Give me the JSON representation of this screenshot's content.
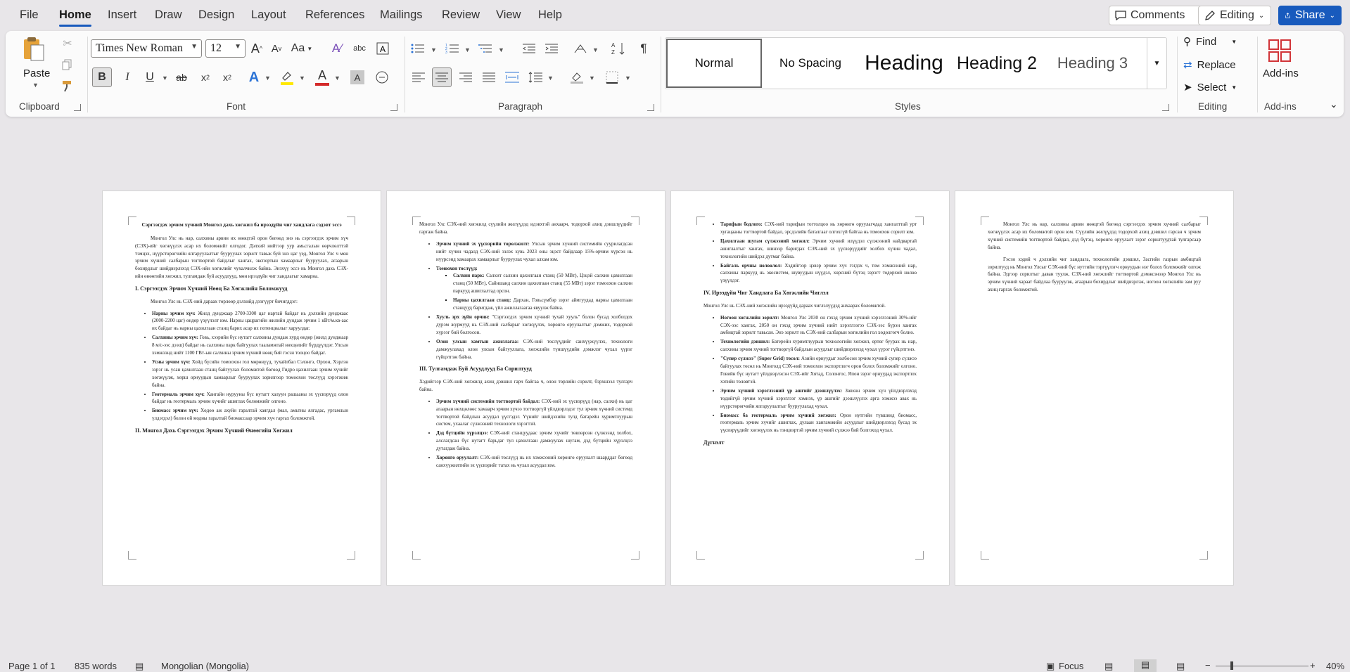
{
  "menu": [
    "File",
    "Home",
    "Insert",
    "Draw",
    "Design",
    "Layout",
    "References",
    "Mailings",
    "Review",
    "View",
    "Help"
  ],
  "menu_active": "Home",
  "topbar": {
    "comments": "Comments",
    "editing": "Editing",
    "share": "Share"
  },
  "ribbon": {
    "clipboard": {
      "label": "Clipboard",
      "paste": "Paste"
    },
    "font": {
      "label": "Font",
      "family": "Times New Roman",
      "size": "12"
    },
    "paragraph": {
      "label": "Paragraph"
    },
    "styles": {
      "label": "Styles",
      "items": [
        "Normal",
        "No Spacing",
        "Heading",
        "Heading 2",
        "Heading 3"
      ]
    },
    "editing": {
      "label": "Editing",
      "find": "Find",
      "replace": "Replace",
      "select": "Select"
    },
    "addins": {
      "label": "Add-ins",
      "button": "Add-ins"
    }
  },
  "status": {
    "page": "Page 1 of 1",
    "words": "835 words",
    "language": "Mongolian (Mongolia)",
    "focus": "Focus",
    "zoom": "40%"
  },
  "pages": [
    {
      "blocks": [
        {
          "t": "title",
          "text": "Сэргээгдэх эрчим хүчний Монгол дахь хөгжил ба ирээдүйн чиг хандлага сэдэвт эссэ"
        },
        {
          "t": "p",
          "text": "Монгол Улс нь нар, салхины арвин их нөөцтэй орон бөгөөд энэ нь сэргээгдэх эрчим хүч (СЭХ)-ийг хөгжүүлэх асар их боломжийг олгодог. Дэлхий нийтээр уур амьсгалын өөрчлөлттэй тэмцэх, нүүрстөрөгчийн ялгаруулалтыг бууруулах зорилт тавьж буй энэ цаг үед, Монгол Улс ч мөн эрчим хүчний салбарын тогтвортой байдлыг хангах, экспортын хамаарлыг бууруулах, агаарын бохирдлыг шийдвэрлэхэд СЭХ-ийн хөгжлийг чухалчилж байна. Энэхүү эссэ нь Монгол дахь СЭХ-ийн өнөөгийн хөгжил, тулгамдаж буй асуудлууд, мөн ирээдүйн чиг хандлагыг хамарна."
        },
        {
          "t": "h",
          "text": "I. Сэргээгдэх Эрчим Хүчний Нөөц Ба Хөгжлийн Боломжууд"
        },
        {
          "t": "p",
          "text": "Монгол Улс нь СЭХ-ний дараах төрлөөр дэлхийд дээгүүрт бичигддэг:"
        },
        {
          "t": "ul",
          "items": [
            {
              "b": "Нарны эрчим хүч:",
              "text": "Жилд дунджаар 2700-3300 цаг нартай байдаг нь дэлхийн дунджаас (2000-2200 цаг) өндөр үзүүлэлт юм. Нарны цацрагийн жилийн дундаж эрчим 1 кВт/м.кв-аас их байдаг нь нарны цахилгаан станц барих асар их потенциалыг харуулдаг."
            },
            {
              "b": "Салхины эрчим хүч:",
              "text": "Говь, хээрийн бүс нутагт салхины дундаж хурд өндөр (жилд дунджаар 8 м/с-ээс дээш) байдаг нь салхины парк байгуулах тааламжтай нөхцөлийг бүрдүүлдэг. Улсын хэмжээнд нийт 1100 ГВт-ын салхины эрчим хүчний нөөц бий гэсэн тооцоо байдаг."
            },
            {
              "b": "Усны эрчим хүч:",
              "text": "Хойд бүсийн томоохон гол мөрөнүүд, тухайлбал Сэлэнгэ, Орхон, Хэрлэн зэрэг нь усан цахилгаан станц байгуулах боломжтой бөгөөд Гидро цахилгаан эрчим хүчийг хөгжүүлж, хөрш орнуудын хамаарлыг бууруулах зорилгоор томоохон төслүүд хэрэгжиж байна."
            },
            {
              "b": "Геотермаль эрчим хүч:",
              "text": "Хангайн нурууны бүс нутагт халуун рашааны эх үүсвэрүүд олон байдаг нь геотермаль эрчим хүчийг ашиглах боломжийг олгоно."
            },
            {
              "b": "Биомасс эрчим хүч:",
              "text": "Хөдөө аж ахуйн гаралтай хаягдал (мал, амьтны ялгадас, ургамлын үлдэгдэл) болон ой модны гаралтай биомассаар эрчим хүч гаргах боломжтой."
            }
          ]
        },
        {
          "t": "h",
          "text": "II. Монгол Дахь Сэргээгдэх Эрчим Хүчний Өнөөгийн Хөгжил"
        }
      ]
    },
    {
      "blocks": [
        {
          "t": "p",
          "noindent": true,
          "text": "Монгол Улс СЭХ-ний хөгжилд сүүлийн жилүүдэд идэвхтэй анхаарч, тодорхой ахиц дэвшлүүдийг гаргаж байна."
        },
        {
          "t": "ul",
          "items": [
            {
              "b": "Эрчим хүчний эх үүсвэрийн төрөлжилт:",
              "text": "Улсын эрчим хүчний системийн суурилагдсан нийт хүчин чадалд СЭХ-ний эзлэх хувь 2023 оны эцэст байдлаар 15%-орчим хүрсэн нь нүүрсэнд хамаарах хамаарлыг бууруулах чухал алхам юм."
            },
            {
              "b": "Томоохон төслүүд:",
              "text": "",
              "sub": [
                {
                  "b": "Салхин парк:",
                  "text": "Салхит салхин цахилгаан станц (50 МВт), Цэцэй салхин цахилгаан станц (50 МВт), Сайншанд салхин цахилгаан станц (55 МВт) зэрэг томоохон салхин паркууд ашиглалтад орсон."
                },
                {
                  "b": "Нарны цахилгаан станц:",
                  "text": "Дархан, Говьсүмбэр зэрэг аймгуудад нарны цахилгаан станцууд баригдаж, үйл ажиллагаагаа явуулж байна."
                }
              ]
            },
            {
              "b": "Хууль эрх зүйн орчин:",
              "text": "\"Сэргээгдэх эрчим хүчний тухай хууль\" болон бусад холбогдох дүрэм журмууд нь СЭХ-ний салбарыг хөгжүүлэх, хөрөнгө оруулалтыг дэмжих, тодорхой хүрээг бий болгосон."
            },
            {
              "b": "Олон улсын хамтын ажиллагаа:",
              "text": "СЭХ-ний төслүүдийг санхүүжүүлэх, технологи дамжуулахад олон улсын байгууллага, хөгжлийн түншүүдийн дэмжлэг чухал үүрэг гүйцэтгэж байна."
            }
          ]
        },
        {
          "t": "h",
          "text": "III. Тулгамдаж Буй Асуудлууд Ба Сорилтууд"
        },
        {
          "t": "p",
          "noindent": true,
          "text": "Хэдийгээр СЭХ-ний хөгжилд ахиц дэвшил гарч байгаа ч, олон төрлийн сорилт, бэрхшээл тулгарч байна."
        },
        {
          "t": "ul",
          "items": [
            {
              "b": "Эрчим хүчний системийн тогтвортой байдал:",
              "text": "СЭХ-ний эх үүсвэрүүд (нар, салхи) нь цаг агаарын нөхцөлөөс хамаарч эрчим хүчээ тогтворгүй үйлдвэрлэдэг тул эрчим хүчний системд тогтвортой байдлын асуудал үүсгэдэг. Үүнийг шийдэхийн тулд батарейн хуримтлуурын систем, ухаалаг сүлжээний технологи хэрэгтэй."
            },
            {
              "b": "Дэд бүтцийн хүрэлцээ:",
              "text": "СЭХ-ний станцуудаас эрчим хүчийг төвлөрсөн сүлжээнд холбох, алслагдсан бүс нутагт барьдаг тул цахилгаан дамжуулах шугам, дэд бүтцийн хүрэлцээ дутагдаж байна."
            },
            {
              "b": "Хөрөнгө оруулалт:",
              "text": "СЭХ-ний төслүүд нь их хэмжээний хөрөнгө оруулалт шаарддаг бөгөөд санхүүжилтийн эх үүсвэрийг татах нь чухал асуудал юм."
            }
          ]
        }
      ]
    },
    {
      "blocks": [
        {
          "t": "ul",
          "items": [
            {
              "b": "Тарифын бодлого:",
              "text": "СЭХ-ний тарифын тогтолцоо нь хөрөнгө оруулагчдад хангалттай урт хугацааны тогтвортой байдал, эрсдэлийн баталгааг олгохгүй байгаа нь томоохон сорилт юм."
            },
            {
              "b": "Цахилгаан шугам сүлжээний хөгжил:",
              "text": "Эрчим хүчний илүүдэл сүлжээний найдвартай ашиглалтыг хангах, шинээр баригдах СЭХ-ний эх үүсвэрүүдийг холбох хүчин чадал, технологийн шийдэл дутмаг байна."
            },
            {
              "b": "Байгаль орчны нөлөөлөл:",
              "text": "Хэдийгээр цэвэр эрчим хүч гэгдэх ч, том хэмжээний нар, салхины паркууд нь экосистем, шувуудын нүүдэл, хөрсний бүтэц зэрэгт тодорхой нөлөө үзүүлдэг."
            }
          ]
        },
        {
          "t": "h",
          "text": "IV. Ирээдүйн Чиг Хандлага Ба Хөгжлийн Чиглэл"
        },
        {
          "t": "p",
          "noindent": true,
          "text": "Монгол Улс нь СЭХ-ний хөгжлийн ирээдүйд дараах чиглэлүүдэд анхаарах боломжтой."
        },
        {
          "t": "ul",
          "items": [
            {
              "b": "Ногоон хөгжлийн зорилт:",
              "text": "Монгол Улс 2030 он гэхэд эрчим хүчний хэрэглээний 30%-ийг СЭХ-ээс хангах, 2050 он гэхэд эрчим хүчний нийт хэрэглээгээ СЭХ-ээс бүрэн хангах амбицтай зорилт тавьсан. Энэ зорилт нь СЭХ-ний салбарын хөгжлийн гол хөдөлгөгч болно."
            },
            {
              "b": "Технологийн дэвшил:",
              "text": "Батерейн хуримтлуурын технологийн хөгжил, өртөг буурах нь нар, салхины эрчим хүчний тогтворгүй байдлын асуудлыг шийдвэрлэхэд чухал үүрэг гүйцэтгэнэ."
            },
            {
              "b": "\"Супер сүлжээ\" (Super Grid) төсөл:",
              "text": "Азийн орнуудыг холбосон эрчим хүчний супер сүлжээ байгуулах төсөл нь Монголд СЭХ-ний томоохон экспортлогч орон болох боломжийг олгоно. Говийн бүс нутагт үйлдвэрлэсэн СЭХ-ийг Хятад, Солонгос, Япон зэрэг орнуудад экспортлох хэтийн төлөвтэй."
            },
            {
              "b": "Эрчим хүчний хэрэглээний үр ашгийг дээшлүүлэх:",
              "text": "Зөвхөн эрчим хүч үйлдвэрлэхэд төдийгүй эрчим хүчний хэрэглээг хэмнэх, үр ашгийг дээшлүүлэх арга хэмжээ авах нь нүүрстөрөгчийн ялгаруулалтыг бууруулахад чухал."
            },
            {
              "b": "Биомасс ба геотермаль эрчим хүчний хөгжил:",
              "text": "Орон нутгийн түвшинд биомасс, геотермаль эрчим хүчийг ашиглах, дулаан хангамжийн асуудлыг шийдвэрлэхэд бусад эх үүсвэрүүдийг хөгжүүлэх нь тэнцвэртэй эрчим хүчний сүлжээ бий болгоход чухал."
            }
          ]
        },
        {
          "t": "h",
          "text": "Дүгнэлт"
        }
      ]
    },
    {
      "blocks": [
        {
          "t": "p",
          "text": "Монгол Улс нь нар, салхины арвин нөөцтэй бөгөөд сэргээгдэх эрчим хүчний салбарыг хөгжүүлэх асар их боломжтой орон юм. Сүүлийн жилүүдэд тодорхой ахиц дэвшил гарсан ч эрчим хүчний системийн тогтвортой байдал, дэд бүтэц, хөрөнгө оруулалт зэрэг сорилтуудтай тулгарсаар байна."
        },
        {
          "t": "p",
          "text": "Гэсэн хэдий ч дэлхийн чиг хандлага, технологийн дэвшил, Засгийн газрын амбицтай зорилтууд нь Монгол Улсыг СЭХ-ний бүс нутгийн тэргүүлэгч орнуудын нэг болох боломжийг олгож байна. Эдгээр сорилтыг даван туулж, СЭХ-ний хөгжлийг тогтвортой дэмжсэнээр Монгол Улс нь эрчим хүчний хараат байдлаа бууруулж, агаарын бохирдлыг шийдвэрлэж, ногоон хөгжлийн зам руу ахиц гаргах боломжтой."
        }
      ]
    }
  ]
}
